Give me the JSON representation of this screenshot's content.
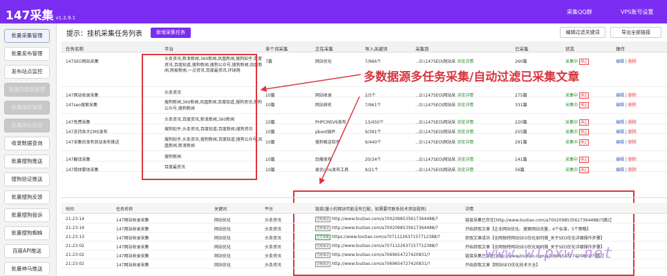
{
  "header": {
    "logo": "147采集",
    "version": "v1.2.9.1",
    "link_group": "采集QQ群",
    "link_vps": "VPS账号设置"
  },
  "sidebar": {
    "items": [
      {
        "label": "批量采集管理",
        "state": "active"
      },
      {
        "label": "批量发布管理",
        "state": "normal"
      },
      {
        "label": "发布站点监控",
        "state": "normal"
      },
      {
        "label": "批量伪原创管理",
        "state": "disabled"
      },
      {
        "label": "批量组织管理",
        "state": "disabled"
      },
      {
        "label": "批量排名监控",
        "state": "disabled"
      },
      {
        "label": "收录数据查询",
        "state": "normal"
      },
      {
        "label": "批量搜狗推送",
        "state": "normal"
      },
      {
        "label": "搜狗验证推送",
        "state": "normal"
      },
      {
        "label": "批量搜狗反馈",
        "state": "normal"
      },
      {
        "label": "批量搜狗投诉",
        "state": "normal"
      },
      {
        "label": "批量搜狗蜘蛛",
        "state": "normal"
      },
      {
        "label": "百度API推送",
        "state": "normal"
      },
      {
        "label": "批量神马推送",
        "state": "normal"
      }
    ]
  },
  "topbar": {
    "title": "提示：挂机采集任务列表",
    "new_button": "新增采集任务",
    "btn_filter": "编辑过滤关键词",
    "btn_export": "导出全部链接"
  },
  "table": {
    "headers": [
      "任务名称",
      "平台",
      "单个词采集",
      "正在采集",
      "导入关键词",
      "采集到",
      "已采集",
      "状态",
      "操作"
    ],
    "rows": [
      {
        "name": "147SEO网站采集",
        "platform": "头条资讯,新浪新闻,360新闻,凤凰新闻,搜狗知乎,百度资讯,百度知道,搜狗新闻,搜狗公众号,搜狗新闻,凤凰新闻,网易新闻,一点资讯,百度最资讯,环球网",
        "per_word": "7篇",
        "collecting": "网站优化",
        "keywords": "7/966个",
        "target": "...D:\\147SEO\\网站采",
        "target_link": "浏览详情",
        "count": "260篇",
        "status": "采集中",
        "stop": "停止",
        "edit": "编辑",
        "delete": "删除"
      },
      {
        "name": "147网站收录采集",
        "platform": "头条资讯",
        "per_word": "10篇",
        "collecting": "网站收录",
        "keywords": "2/5个",
        "target": "...D:\\147SEO\\网站采",
        "target_link": "浏览详情",
        "count": "275篇",
        "status": "采集中",
        "stop": "停止",
        "edit": "编辑",
        "delete": "删除"
      },
      {
        "name": "147seo搜索采集",
        "platform": "搜狗新闻,360新闻,凤凰新闻,百度知道,搜狗资讯,搜狗公众号,搜狗新闻",
        "per_word": "10篇",
        "collecting": "网站排名",
        "keywords": "7/961个",
        "target": "...D:\\147SEO\\网站采",
        "target_link": "浏览详情",
        "count": "331篇",
        "status": "采集中",
        "stop": "停止",
        "edit": "编辑",
        "delete": "删除"
      },
      {
        "name": "147免费采集",
        "platform": "头条资讯,百度资讯,新浪新闻,360新闻",
        "per_word": "10篇",
        "collecting": "PHPCMSV9发布",
        "keywords": "13/450个",
        "target": "...D:\\147SEO\\网站采",
        "target_link": "浏览详情",
        "count": "220篇",
        "status": "采集中",
        "stop": "停止",
        "edit": "编辑",
        "delete": "删除"
      },
      {
        "name": "147支持各大CMS发布",
        "platform": "搜狗知乎,头条资讯,百度知道,百度新闻,搜狗资讯",
        "per_word": "10篇",
        "collecting": "pboot插件",
        "keywords": "9/391个",
        "target": "...D:\\147SEO\\网站采",
        "target_link": "浏览详情",
        "count": "255篇",
        "status": "采集中",
        "stop": "停止",
        "edit": "编辑",
        "delete": "删除"
      },
      {
        "name": "147采集后发布到站发布推送",
        "platform": "搜狗知乎,头条资讯,搜狗新闻,百度知道,搜狗公众号,凤凰新闻,新浪新闻",
        "per_word": "10篇",
        "collecting": "搜狗推送软件",
        "keywords": "9/440个",
        "target": "...D:\\147SEO\\网站采",
        "target_link": "浏览详情",
        "count": "291篇",
        "status": "采集中",
        "stop": "停止",
        "edit": "编辑",
        "delete": "删除"
      },
      {
        "name": "147翻译采集",
        "platform": "搜狗新闻",
        "per_word": "10篇",
        "collecting": "劲爆发布",
        "keywords": "20/34个",
        "target": "...D:\\147SEO\\网站采",
        "target_link": "浏览详情",
        "count": "141篇",
        "status": "采集中",
        "stop": "停止",
        "edit": "编辑",
        "delete": "删除"
      },
      {
        "name": "147简体繁体采集",
        "platform": "百度最资讯",
        "per_word": "10篇",
        "collecting": "易优cms发布工具",
        "keywords": "9/21个",
        "target": "...D:\\147SEO\\网站采",
        "target_link": "浏览详情",
        "count": "56篇",
        "status": "采集中",
        "stop": "停止",
        "edit": "编辑",
        "delete": "删除"
      }
    ]
  },
  "annotation": "多数据源多任务采集/自动过滤已采集文章",
  "log": {
    "headers": [
      "时间",
      "任务名称",
      "关键词",
      "平台",
      "链接(量小的网站可能没有已配，如需要可联系技术添加规则)",
      "详情"
    ],
    "rows": [
      {
        "time": "21:23:14",
        "task": "147网站收录采集",
        "kw": "网站优化",
        "platform": "头条资讯",
        "tag": "已经采过",
        "url": "http://www.toutiao.com/a7002098535617364488/?",
        "detail": "链接采集已存在[http://www.toutiao.com/a7002098535617364488/?]跳过"
      },
      {
        "time": "21:23:14",
        "task": "147网站收录采集",
        "kw": "网站优化",
        "platform": "头条资讯",
        "tag": "已经采过",
        "url": "http://www.toutiao.com/a7002098535617364488/?",
        "detail": "开始获取文章【企业网站优化、搜索网站流量，4个标准，5个策略】"
      },
      {
        "time": "21:23:13",
        "task": "147网站收录采集",
        "kw": "网站优化",
        "platform": "头条资讯",
        "tag": "正在采集",
        "url": "https://www.toutiao.com/a7071122637157712388/?",
        "detail": "获取文章成功【全网独特网站SEO优化如何做_关于SEO优化详细操作步骤】"
      },
      {
        "time": "21:23:02",
        "task": "147网站收录采集",
        "kw": "网站优化",
        "platform": "头条资讯",
        "tag": "已经采过",
        "url": "http://www.toutiao.com/a7071122637157712388/?",
        "detail": "开始获取文章【全网独特网站SEO优化如何做_关于SEO优化详细操作步骤】"
      },
      {
        "time": "21:23:02",
        "task": "147网站收录采集",
        "kw": "网站优化",
        "platform": "头条资讯",
        "tag": "已经采过",
        "url": "http://www.toutiao.com/a7069654727420831/?",
        "detail": "链接采集已存在[http://www.toutiao.com/a7069654727420831/?]跳过"
      },
      {
        "time": "21:23:02",
        "task": "147网站收录采集",
        "kw": "网站优化",
        "platform": "头条资讯",
        "tag": "已经采过",
        "url": "http://www.toutiao.com/a7069654727420831/?",
        "detail": "开始获取文章【网站SEO优化技术大全】"
      }
    ]
  },
  "watermark": "www.wlpxw.net",
  "colors": {
    "brand": "#7a2df0",
    "annotation": "#d9363e",
    "status_green": "#2e8b2e",
    "link_blue": "#3a63b8"
  }
}
